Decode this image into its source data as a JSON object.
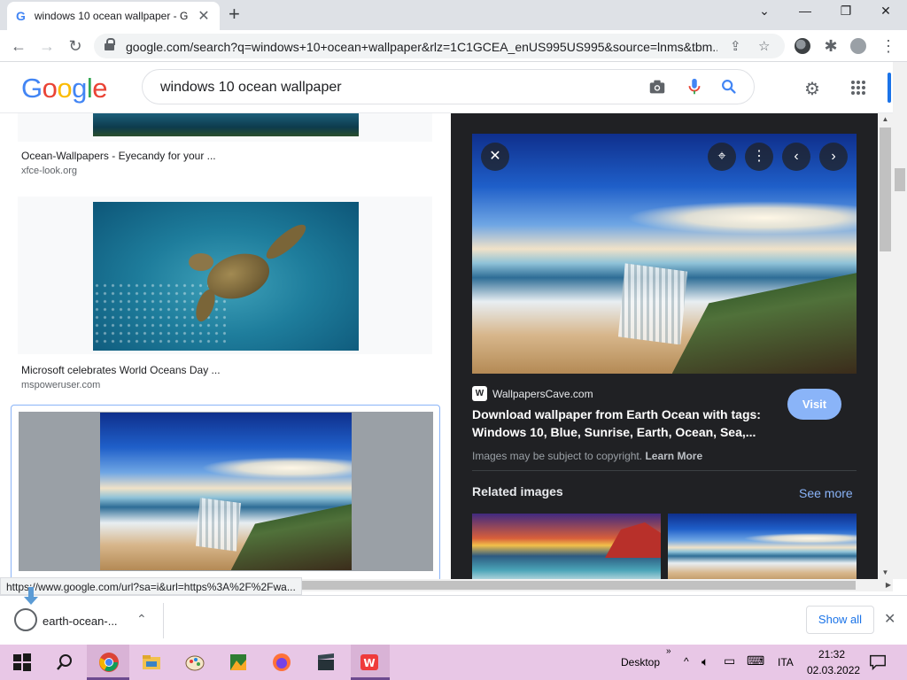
{
  "browser": {
    "tab_title": "windows 10 ocean wallpaper - G",
    "url": "google.com/search?q=windows+10+ocean+wallpaper&rlz=1C1GCEA_enUS995US995&source=lnms&tbm...",
    "status_url": "https://www.google.com/url?sa=i&url=https%3A%2F%2Fwa...",
    "icons": [
      "google-favicon",
      "close-icon",
      "new-tab-icon",
      "chevron-down-icon",
      "minimize-icon",
      "restore-icon",
      "back-icon",
      "forward-icon",
      "reload-icon",
      "lock-icon",
      "share-icon",
      "star-icon",
      "extensions-icon",
      "profile-icon",
      "menu-icon"
    ]
  },
  "google": {
    "logo_letters": [
      {
        "char": "G",
        "color": "#4285F4"
      },
      {
        "char": "o",
        "color": "#EA4335"
      },
      {
        "char": "o",
        "color": "#FBBC05"
      },
      {
        "char": "g",
        "color": "#4285F4"
      },
      {
        "char": "l",
        "color": "#34A853"
      },
      {
        "char": "e",
        "color": "#EA4335"
      }
    ],
    "query": "windows 10 ocean wallpaper"
  },
  "results": [
    {
      "caption": "Ocean-Wallpapers - Eyecandy for your ...",
      "source": "xfce-look.org"
    },
    {
      "caption": "Microsoft celebrates World Oceans Day ...",
      "source": "mspoweruser.com"
    }
  ],
  "preview": {
    "site": "WallpapersCave.com",
    "title": "Download wallpaper from Earth Ocean with tags: Windows 10, Blue, Sunrise, Earth, Ocean, Sea,...",
    "visit_label": "Visit",
    "copyright": "Images may be subject to copyright.",
    "learn_more": "Learn More",
    "related_label": "Related images",
    "see_more": "See more"
  },
  "download": {
    "filename": "earth-ocean-...",
    "show_all": "Show all"
  },
  "taskbar": {
    "desktop_label": "Desktop",
    "language": "ITA",
    "time": "21:32",
    "date": "02.03.2022"
  },
  "colors": {
    "accent": "#1a73e8",
    "panel_bg": "#202124",
    "visit_button": "#8ab4f8",
    "taskbar_bg": "#e8c7e6"
  }
}
